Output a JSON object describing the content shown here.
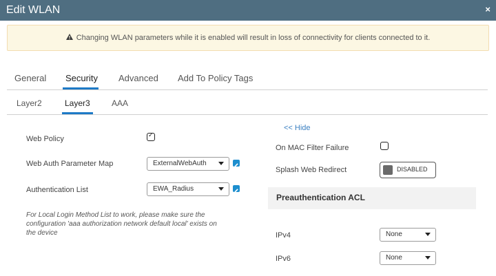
{
  "window": {
    "title": "Edit WLAN",
    "close_icon": "close-icon",
    "close_glyph": "×"
  },
  "warning": {
    "icon": "warning-triangle-icon",
    "text": "Changing WLAN parameters while it is enabled will result in loss of connectivity for clients connected to it."
  },
  "tabs": [
    {
      "label": "General"
    },
    {
      "label": "Security",
      "active": true
    },
    {
      "label": "Advanced"
    },
    {
      "label": "Add To Policy Tags"
    }
  ],
  "subtabs": [
    {
      "label": "Layer2"
    },
    {
      "label": "Layer3",
      "active": true
    },
    {
      "label": "AAA"
    }
  ],
  "left": {
    "web_policy": {
      "label": "Web Policy",
      "checked": true
    },
    "web_auth_param_map": {
      "label": "Web Auth Parameter Map",
      "value": "ExternalWebAuth"
    },
    "authentication_list": {
      "label": "Authentication List",
      "value": "EWA_Radius"
    },
    "note": "For Local Login Method List to work, please make sure the configuration 'aaa authorization network default local' exists on the device"
  },
  "right": {
    "hide_link": "<< Hide",
    "mac_filter_failure": {
      "label": "On MAC Filter Failure",
      "checked": false
    },
    "splash_web_redirect": {
      "label": "Splash Web Redirect",
      "state": "DISABLED"
    },
    "preauth_acl": {
      "title": "Preauthentication ACL",
      "ipv4": {
        "label": "IPv4",
        "value": "None"
      },
      "ipv6": {
        "label": "IPv6",
        "value": "None"
      }
    }
  },
  "colors": {
    "titlebar": "#4f6e81",
    "accent": "#1d7ac6",
    "warning_bg": "#fcf7e3"
  }
}
